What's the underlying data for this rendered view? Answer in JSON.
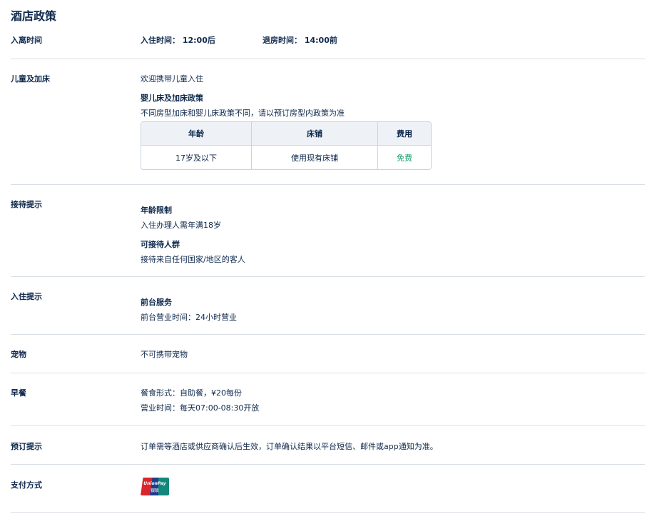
{
  "page_title": "酒店政策",
  "checkin_time": {
    "label": "入离时间",
    "checkin": "入住时间： 12:00后",
    "checkout": "退房时间： 14:00前"
  },
  "children": {
    "label": "儿童及加床",
    "welcome": "欢迎携带儿童入住",
    "policy_title": "婴儿床及加床政策",
    "policy_desc": "不同房型加床和婴儿床政策不同，请以预订房型内政策为准",
    "table": {
      "headers": [
        "年龄",
        "床铺",
        "费用"
      ],
      "rows": [
        [
          "17岁及以下",
          "使用现有床铺",
          "免费"
        ]
      ]
    }
  },
  "reception": {
    "label": "接待提示",
    "age_title": "年龄限制",
    "age_desc": "入住办理人需年满18岁",
    "guests_title": "可接待人群",
    "guests_desc": "接待来自任何国家/地区的客人"
  },
  "checkin_tips": {
    "label": "入住提示",
    "desk_title": "前台服务",
    "desk_desc": "前台营业时间：24小时营业"
  },
  "pets": {
    "label": "宠物",
    "desc": "不可携带宠物"
  },
  "breakfast": {
    "label": "早餐",
    "format": "餐食形式：自助餐，¥20每份",
    "hours": "营业时间：每天07:00-08:30开放"
  },
  "booking": {
    "label": "预订提示",
    "desc": "订单需等酒店或供应商确认后生效，订单确认结果以平台短信、邮件或app通知为准。"
  },
  "payment": {
    "label": "支付方式",
    "logo_text": "UnionPay",
    "logo_text_cn": "银联"
  },
  "colors": {
    "text": "#0f294d",
    "divider": "#dadfe6",
    "free": "#1a9f6b",
    "table_header_bg": "#eef1f6"
  }
}
